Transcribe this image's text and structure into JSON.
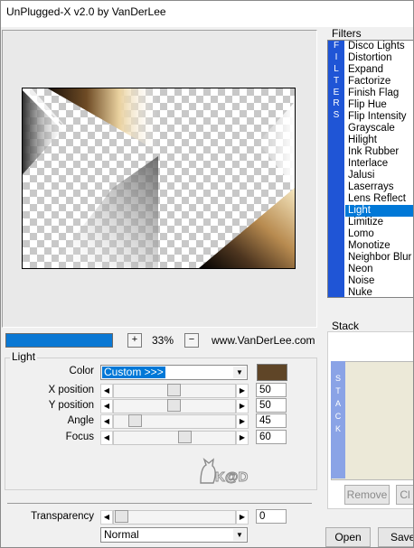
{
  "title": "UnPlugged-X v2.0 by VanDerLee",
  "preview": {
    "zoom": "33%",
    "zoom_in": "+",
    "zoom_out": "−",
    "website": "www.VanDerLee.com"
  },
  "filters": {
    "heading": "Filters",
    "strip_letters": [
      "F",
      "I",
      "L",
      "T",
      "E",
      "R",
      "S"
    ],
    "items": [
      "Disco Lights",
      "Distortion",
      "Expand",
      "Factorize",
      "Finish Flag",
      "Flip Hue",
      "Flip Intensity",
      "Grayscale",
      "Hilight",
      "Ink Rubber",
      "Interlace",
      "Jalusi",
      "Laserrays",
      "Lens Reflect",
      "Light",
      "Limitize",
      "Lomo",
      "Monotize",
      "Neighbor Blur",
      "Neon",
      "Noise",
      "Nuke"
    ],
    "selected": "Light"
  },
  "light": {
    "group_label": "Light",
    "color_label": "Color",
    "color_value": "Custom >>>",
    "swatch_color": "#5f4527",
    "params": [
      {
        "label": "X position",
        "value": "50"
      },
      {
        "label": "Y position",
        "value": "50"
      },
      {
        "label": "Angle",
        "value": "45"
      },
      {
        "label": "Focus",
        "value": "60"
      }
    ],
    "watermark": "K@D"
  },
  "transparency": {
    "label": "Transparency",
    "value": "0",
    "blend": "Normal"
  },
  "stack": {
    "heading": "Stack",
    "strip_letters": [
      "S",
      "T",
      "A",
      "C",
      "K"
    ],
    "remove": "Remove",
    "clear": "Cl"
  },
  "buttons": {
    "open": "Open",
    "save": "Save"
  }
}
